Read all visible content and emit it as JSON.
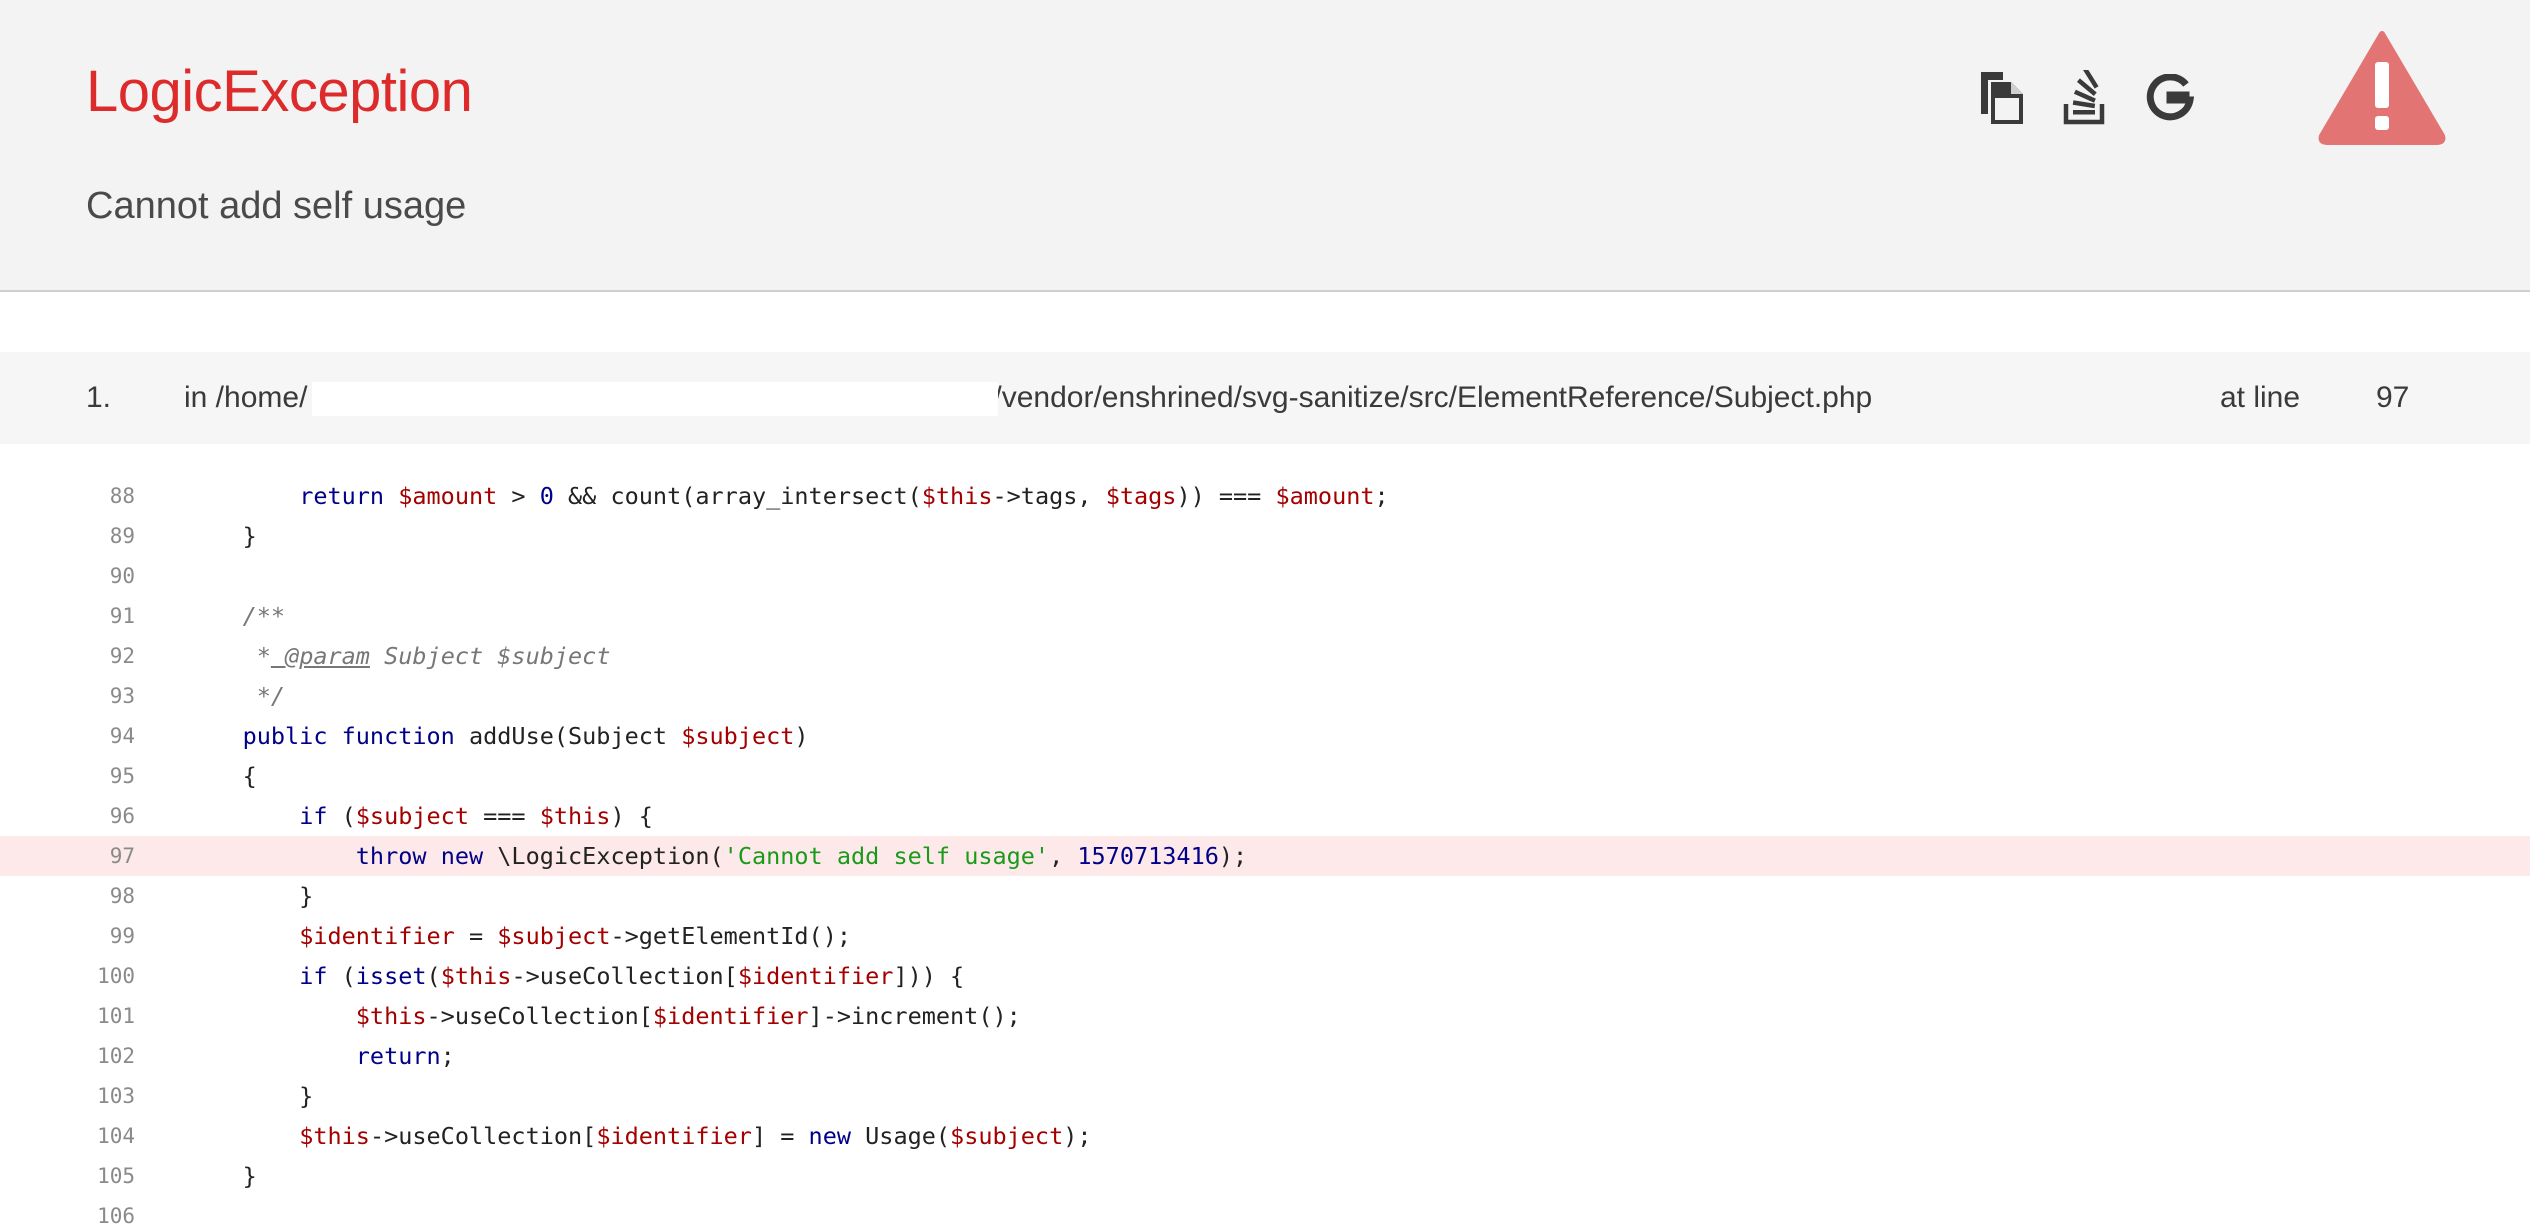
{
  "header": {
    "title": "LogicException",
    "message": "Cannot add self usage",
    "icons": [
      "copy-icon",
      "stackoverflow-icon",
      "google-icon",
      "warning-icon"
    ],
    "colors": {
      "title": "#dd2b2b",
      "warning": "#e27474",
      "highlight": "#fde9e9"
    }
  },
  "trace": {
    "number": "1.",
    "file_prefix": "in /home/",
    "file_suffix": "/vendor/enshrined/svg-sanitize/src/ElementReference/Subject.php",
    "at_label": "at line",
    "line": "97"
  },
  "code": {
    "highlight_line": "97",
    "lines": [
      {
        "n": "88"
      },
      {
        "n": "89"
      },
      {
        "n": "90"
      },
      {
        "n": "91"
      },
      {
        "n": "92"
      },
      {
        "n": "93"
      },
      {
        "n": "94"
      },
      {
        "n": "95"
      },
      {
        "n": "96"
      },
      {
        "n": "97"
      },
      {
        "n": "98"
      },
      {
        "n": "99"
      },
      {
        "n": "100"
      },
      {
        "n": "101"
      },
      {
        "n": "102"
      },
      {
        "n": "103"
      },
      {
        "n": "104"
      },
      {
        "n": "105"
      },
      {
        "n": "106"
      }
    ]
  }
}
